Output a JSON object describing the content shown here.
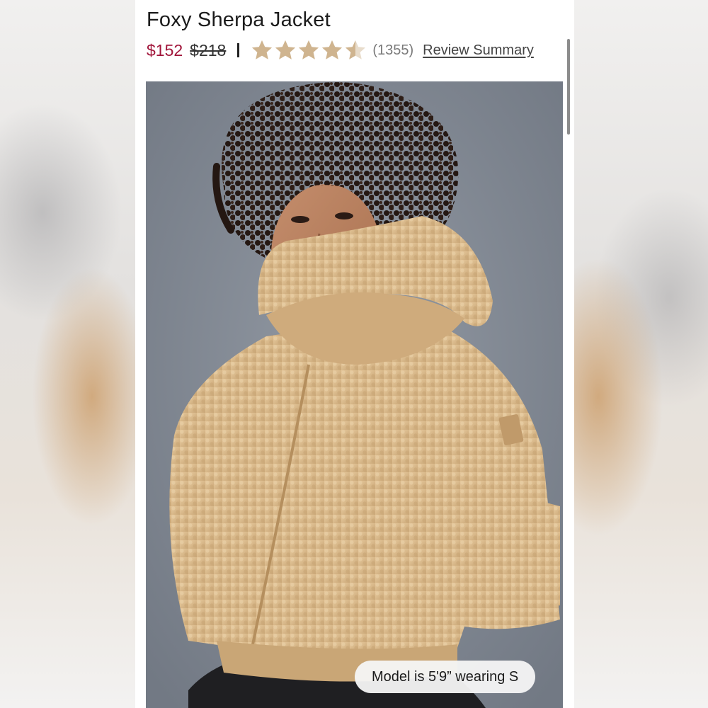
{
  "product": {
    "title": "Foxy Sherpa Jacket",
    "sale_price": "$152",
    "original_price": "$218",
    "rating": 4.5,
    "star_color": "#cfb48f",
    "review_count": "(1355)",
    "review_summary_label": "Review Summary"
  },
  "photo": {
    "alt": "Model wearing a tan sherpa hooded jacket",
    "model_info": "Model is 5'9” wearing S"
  },
  "colors": {
    "sale_price": "#a1153a",
    "jacket": "#d9b98b",
    "photo_background": "#7f8691"
  }
}
